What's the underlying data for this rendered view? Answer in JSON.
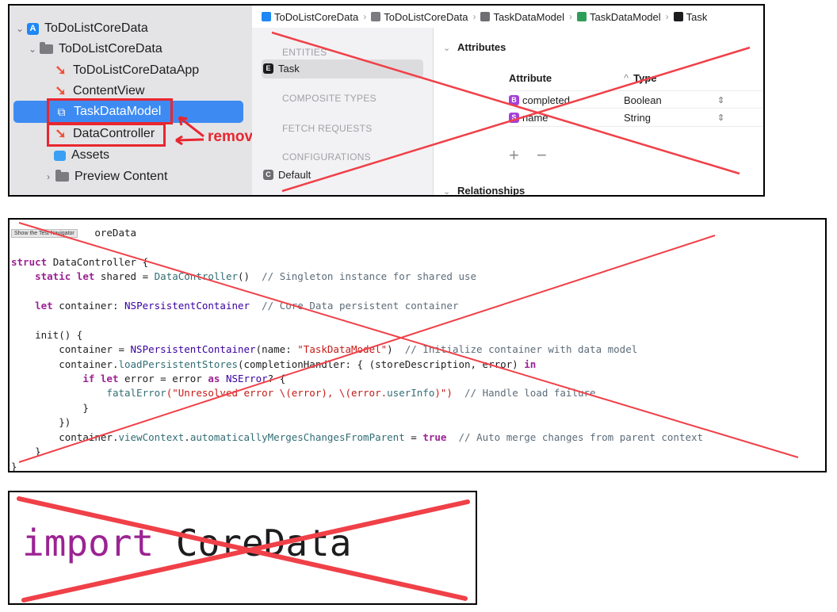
{
  "navigator": {
    "project": "ToDoListCoreData",
    "group": "ToDoListCoreData",
    "files": [
      "ToDoListCoreDataApp",
      "ContentView",
      "TaskDataModel",
      "DataController",
      "Assets"
    ],
    "preview_group": "Preview Content",
    "annotation": "remove",
    "colors": {
      "selection": "#3d8bf2",
      "annotation": "#e8262f"
    }
  },
  "breadcrumb": [
    "ToDoListCoreData",
    "ToDoListCoreData",
    "TaskDataModel",
    "TaskDataModel",
    "Task"
  ],
  "outline": {
    "entities_header": "ENTITIES",
    "entity": "Task",
    "composite_header": "COMPOSITE TYPES",
    "fetch_header": "FETCH REQUESTS",
    "config_header": "CONFIGURATIONS",
    "config": "Default"
  },
  "attributes": {
    "header": "Attributes",
    "col_attribute": "Attribute",
    "col_type": "Type",
    "rows": [
      {
        "badge": "B",
        "name": "completed",
        "type": "Boolean"
      },
      {
        "badge": "S",
        "name": "name",
        "type": "String"
      }
    ],
    "add_remove": "+ −",
    "relationships_header": "Relationships"
  },
  "code": {
    "tooltip": "Show the Test Navigator",
    "line1_tail": "oreData",
    "struct_kw": "struct",
    "struct_name": "DataController {",
    "static_kw": "static let",
    "shared_rest": "shared = ",
    "shared_call": "DataController",
    "shared_parens": "()",
    "shared_comment": "// Singleton instance for shared use",
    "let_kw": "let",
    "container_decl": "container: ",
    "container_type": "NSPersistentContainer",
    "container_comment": "// Core Data persistent container",
    "init_line": "init() {",
    "assign": "container = ",
    "npc": "NSPersistentContainer",
    "name_arg": "(name: ",
    "model_str": "\"TaskDataModel\"",
    "close_paren": ")",
    "init_comment": "// Initialize container with data model",
    "load_prefix": "container.",
    "load_call": "loadPersistentStores",
    "load_arg": "(completionHandler: { (storeDescription, error) ",
    "in_kw": "in",
    "if_let": "if let",
    "error_eq": " error = error ",
    "as_kw": "as",
    "nserror": "NSError",
    "q_brace": "? {",
    "fatal": "fatalError",
    "unresolved": "(\"Unresolved error \\(error), \\(error.",
    "user_info": "userInfo",
    "unresolved_end": ")\")",
    "fatal_comment": "// Handle load failure",
    "inner_close": "}",
    "closure_close": "})",
    "view_prefix": "container.",
    "view_ctx": "viewContext",
    "dot": ".",
    "auto_merge": "automaticallyMergesChangesFromParent",
    "eq": " = ",
    "true_kw": "true",
    "merge_comment": "// Auto merge changes from parent context",
    "init_close": "}",
    "struct_close": "}"
  },
  "zoom": {
    "import_kw": "import",
    "module": "CoreData"
  }
}
